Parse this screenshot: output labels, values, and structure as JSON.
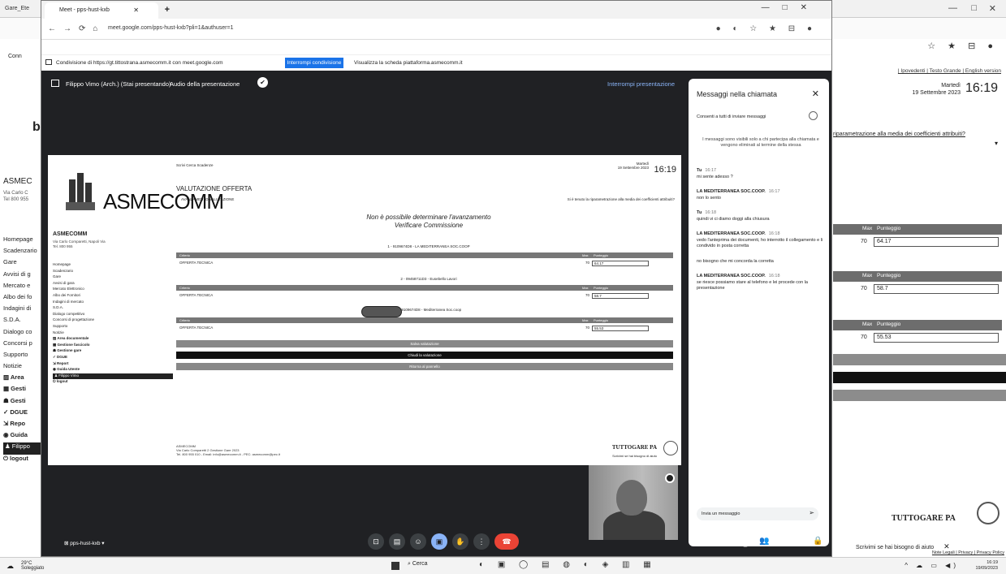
{
  "bg_browser": {
    "tab_title": "Gare_Ete",
    "bookmark": "Conn",
    "window_controls": [
      "—",
      "□",
      "✕"
    ]
  },
  "bg_page": {
    "big_letter": "b",
    "org": "ASMEC",
    "address": "Via Carlo C\nTel 800 955",
    "nav": [
      {
        "label": "Homepage",
        "style": ""
      },
      {
        "label": "Scadenzario",
        "style": ""
      },
      {
        "label": "Gare",
        "style": ""
      },
      {
        "label": "Avvisi di g",
        "style": ""
      },
      {
        "label": "Mercato e",
        "style": ""
      },
      {
        "label": "Albo dei fo",
        "style": ""
      },
      {
        "label": "Indagini di",
        "style": ""
      },
      {
        "label": "S.D.A.",
        "style": ""
      },
      {
        "label": "Dialogo co",
        "style": ""
      },
      {
        "label": "Concorsi p",
        "style": ""
      },
      {
        "label": "Supporto",
        "style": ""
      },
      {
        "label": "Notizie",
        "style": ""
      },
      {
        "label": "▨ Area",
        "style": "dark"
      },
      {
        "label": "▦ Gesti",
        "style": "dark"
      },
      {
        "label": "☗ Gesti",
        "style": "dark"
      },
      {
        "label": "✓ DGUE",
        "style": "dark"
      },
      {
        "label": "⇲ Repo",
        "style": "dark"
      },
      {
        "label": "◉ Guida",
        "style": "dark"
      },
      {
        "label": "♟ Filippo",
        "style": "sel"
      },
      {
        "label": "⏻ logout",
        "style": "dark"
      }
    ],
    "lang_links": "| Ipovedenti | Testo Grande | English version",
    "day": "Martedì",
    "date": "19 Settembre 2023",
    "time": "16:19",
    "question": "riparametrazione alla media dei coefficienti attribuiti?",
    "table_header_max": "Max",
    "table_header_score": "Punteggio",
    "rows": [
      {
        "max": "70",
        "score": "64.17"
      },
      {
        "max": "70",
        "score": "58.7"
      },
      {
        "max": "70",
        "score": "55.53"
      }
    ],
    "footer_logo": "TUTTOGARE PA",
    "help": "Scrivimi se hai bisogno di aiuto",
    "help_close": "✕",
    "privacy": "Note Legali | Privacy | Privacy Policy"
  },
  "meet": {
    "tab_title": "Meet - pps-hust-kxb",
    "url": "meet.google.com/pps-hust-kxb?pli=1&authuser=1",
    "infobar_msg": "Condivisione di https://gt.tittostrana.asmecomm.it con meet.google.com",
    "stop_sharing": "Interrompi condivisione",
    "hide": "Visualizza la scheda piattaforma.asmecomm.it",
    "presenter": "Filippo Vimo (Arch.) (Stai presentando)",
    "audio": "Audio della presentazione",
    "stop_presenting": "Interrompi presentazione",
    "meet_code": "pps-hust-kxb",
    "controls": [
      "⊡",
      "▤",
      "☺",
      "▣",
      "✋",
      "⋮"
    ],
    "right_controls": [
      "ⓘ",
      "👥",
      "✉",
      "△",
      "🔒"
    ]
  },
  "shared": {
    "logo": "ASMECOMM",
    "org": "ASMECOMM",
    "org_address": "Via Carlo Comparetti, Napoli Via\nTel. 800 955",
    "nav": [
      {
        "label": "Homepage",
        "style": ""
      },
      {
        "label": "Scadenzario",
        "style": ""
      },
      {
        "label": "Gare",
        "style": ""
      },
      {
        "label": "Avvisi di gara",
        "style": ""
      },
      {
        "label": "Mercato Elettronico",
        "style": ""
      },
      {
        "label": "Albo dei Fornitori",
        "style": ""
      },
      {
        "label": "Indagini di mercato",
        "style": ""
      },
      {
        "label": "S.D.A.",
        "style": ""
      },
      {
        "label": "Dialogo competitivo",
        "style": ""
      },
      {
        "label": "Concorsi di progettazione",
        "style": ""
      },
      {
        "label": "Supporto",
        "style": ""
      },
      {
        "label": "Notizie",
        "style": ""
      },
      {
        "label": "▨ Area documentale",
        "style": "b"
      },
      {
        "label": "▦ Gestione fascicolo",
        "style": "b"
      },
      {
        "label": "☗ Gestione gare",
        "style": "b"
      },
      {
        "label": "✓ DGUE",
        "style": "b"
      },
      {
        "label": "⇲ Report",
        "style": "b"
      },
      {
        "label": "◉ Guida Utente",
        "style": "b"
      },
      {
        "label": "♟ Filippo Vimo",
        "style": "sel"
      },
      {
        "label": "⏻ logout",
        "style": "b"
      }
    ],
    "icons_row": "Scrivi  Cerca  Scadenze",
    "date": "Martedì\n19 Settembre 2023",
    "time": "16:19",
    "title": "VALUTAZIONE OFFERTA",
    "subtitle": "AVANZAMENTO VALUTAZIONE",
    "question": "Si è tenuto la riparametrazione alla media dei coefficienti attribuiti?",
    "warning1": "Non è possibile determinare l'avanzamento",
    "warning2": "Verificare Commissione",
    "lots": [
      {
        "title": "1 - 9109674D8 - LA MEDITERRANEA SOC.COOP",
        "row": "OFFERTA TECNICA",
        "max": "70",
        "score": "64.17"
      },
      {
        "title": "2 - 09458711D3 - Eusebello Lavori",
        "row": "OFFERTA TECNICA",
        "max": "70",
        "score": "58.7"
      },
      {
        "title": "3 - 9109674D8 - Mediterranea Soc.coop",
        "row": "OFFERTA TECNICA",
        "max": "70",
        "score": "55.53"
      }
    ],
    "th_name": "Criterio",
    "th_max": "Max",
    "th_score": "Punteggio",
    "bar1": "Salva valutazione",
    "bar2": "Chiudi la valutazione",
    "bar3": "Ritorna al pannello",
    "footer": "ASMECOMM\nVia Carlo Comparetti 2 Gestione Gare 2023\nTel. 800 955 010 - Email: info@asmecomm.it - PEC: asmecomm@pec.it",
    "footer_logo": "TUTTOGARE PA",
    "footer_help": "Scrivimi se hai bisogno di aiuto"
  },
  "chat": {
    "title": "Messaggi nella chiamata",
    "close": "✕",
    "allow": "Consenti a tutti di inviare messaggi",
    "notice": "I messaggi sono visibili solo a chi partecipa alla chiamata e vengono eliminati al termine della stessa",
    "messages": [
      {
        "sender": "Tu",
        "time": "16:17",
        "text": "mi sente adesso ?"
      },
      {
        "sender": "LA MEDITERRANEA SOC.COOP.",
        "time": "16:17",
        "text": "non lo sento"
      },
      {
        "sender": "Tu",
        "time": "16:18",
        "text": "quindi vi ci diamo doggi alla chiusura"
      },
      {
        "sender": "LA MEDITERRANEA SOC.COOP.",
        "time": "16:18",
        "text": "vedo l'anteprima dei documenti, ho interrotto il collegamento e li condivido in posta corretta"
      },
      {
        "sender": "",
        "time": "",
        "text": "no bisogno che mi concorda la corretta"
      },
      {
        "sender": "LA MEDITERRANEA SOC.COOP.",
        "time": "16:18",
        "text": "se riesce possiamo stare al telefono e lei procede con la presentazione"
      }
    ],
    "input_placeholder": "Invia un messaggio",
    "send_icon": "➢"
  },
  "taskbar": {
    "weather_temp": "29°C",
    "weather_desc": "Soleggiato",
    "search": "Cerca",
    "apps": "◐ ▣ ◯ ▤ ◍ ◐ ◈ ▥ ▦",
    "tray": "^ ☁ ▭ ◀)",
    "time": "16:19",
    "date": "19/09/2023"
  }
}
